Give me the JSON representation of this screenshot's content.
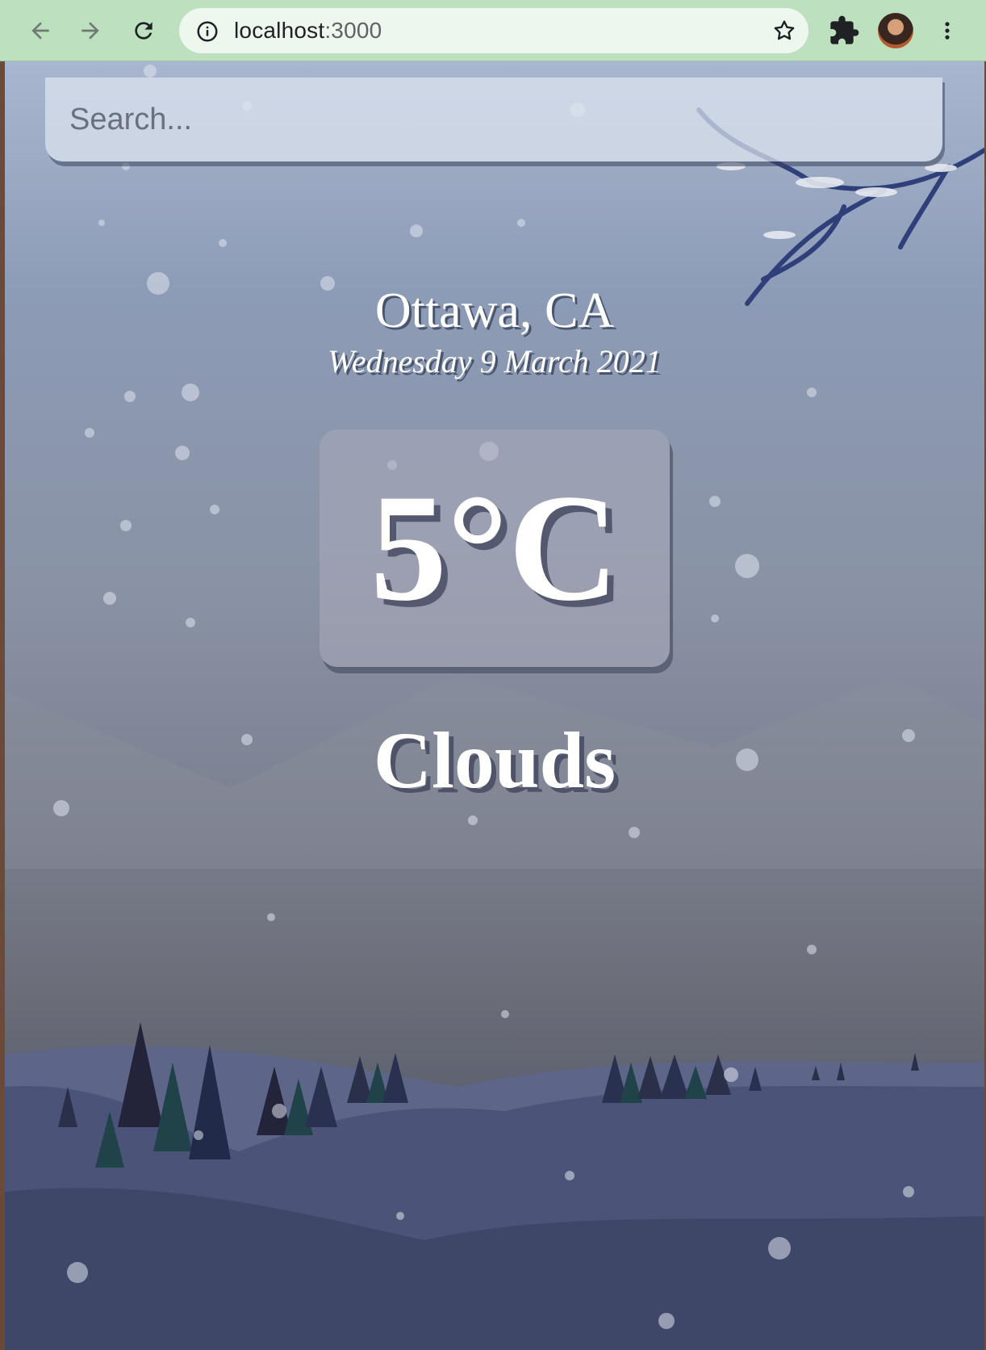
{
  "browser": {
    "url_host": "localhost",
    "url_port": ":3000",
    "icons": [
      "back-arrow-icon",
      "forward-arrow-icon",
      "reload-icon",
      "info-icon",
      "star-icon",
      "puzzle-icon",
      "profile-avatar",
      "more-vert-icon"
    ]
  },
  "search": {
    "placeholder": "Search...",
    "value": ""
  },
  "weather": {
    "location": "Ottawa, CA",
    "date": "Wednesday 9 March 2021",
    "temperature": "5°C",
    "condition": "Clouds"
  }
}
